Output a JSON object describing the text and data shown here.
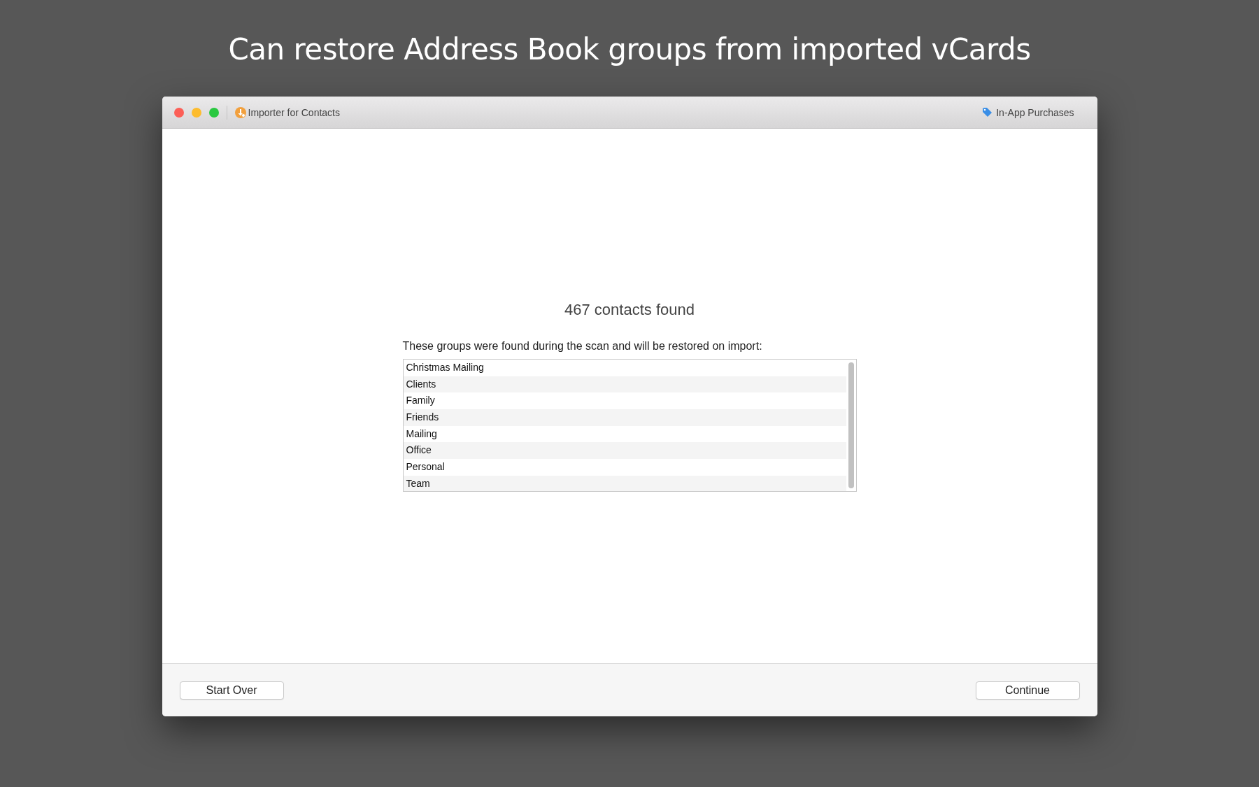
{
  "headline": "Can restore Address Book groups from imported vCards",
  "window": {
    "title": "Importer for Contacts",
    "toolbar_link": "In-App Purchases"
  },
  "result": {
    "heading": "467 contacts found",
    "description": "These groups were found during the scan and will be restored on import:"
  },
  "groups": [
    "Christmas Mailing",
    "Clients",
    "Family",
    "Friends",
    "Mailing",
    "Office",
    "Personal",
    "Team"
  ],
  "buttons": {
    "left": "Start Over",
    "right": "Continue"
  }
}
